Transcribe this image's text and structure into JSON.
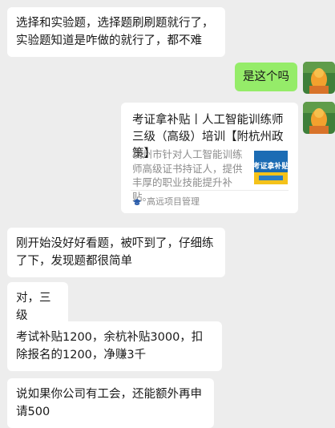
{
  "messages": [
    {
      "side": "left",
      "text": "选择和实验题，选择题刷刷题就行了，实验题知道是咋做的就行了，都不难"
    },
    {
      "side": "right",
      "text": "是这个吗"
    },
    {
      "side": "left",
      "type": "card",
      "title": "考证拿补贴丨人工智能训练师三级（高级）培训【附杭州政策】",
      "desc": "杭州市针对人工智能训练师高级证书持证人，提供丰厚的职业技能提升补贴。",
      "thumb_text": "考证拿补贴",
      "source": "高远项目管理"
    },
    {
      "side": "left",
      "text": "刚开始没好好看题，被吓到了，仔细练了下，发现题都很简单"
    },
    {
      "side": "left",
      "text": "对，三级"
    },
    {
      "side": "left",
      "text": "考试补贴1200，余杭补贴3000，扣除报名的1200，净赚3千"
    },
    {
      "side": "left",
      "text": "说如果你公司有工会，还能额外再申请500"
    }
  ],
  "colors": {
    "background": "#ededed",
    "bubble_other": "#ffffff",
    "bubble_self": "#95ec69",
    "muted_text": "#8c8c8c"
  }
}
